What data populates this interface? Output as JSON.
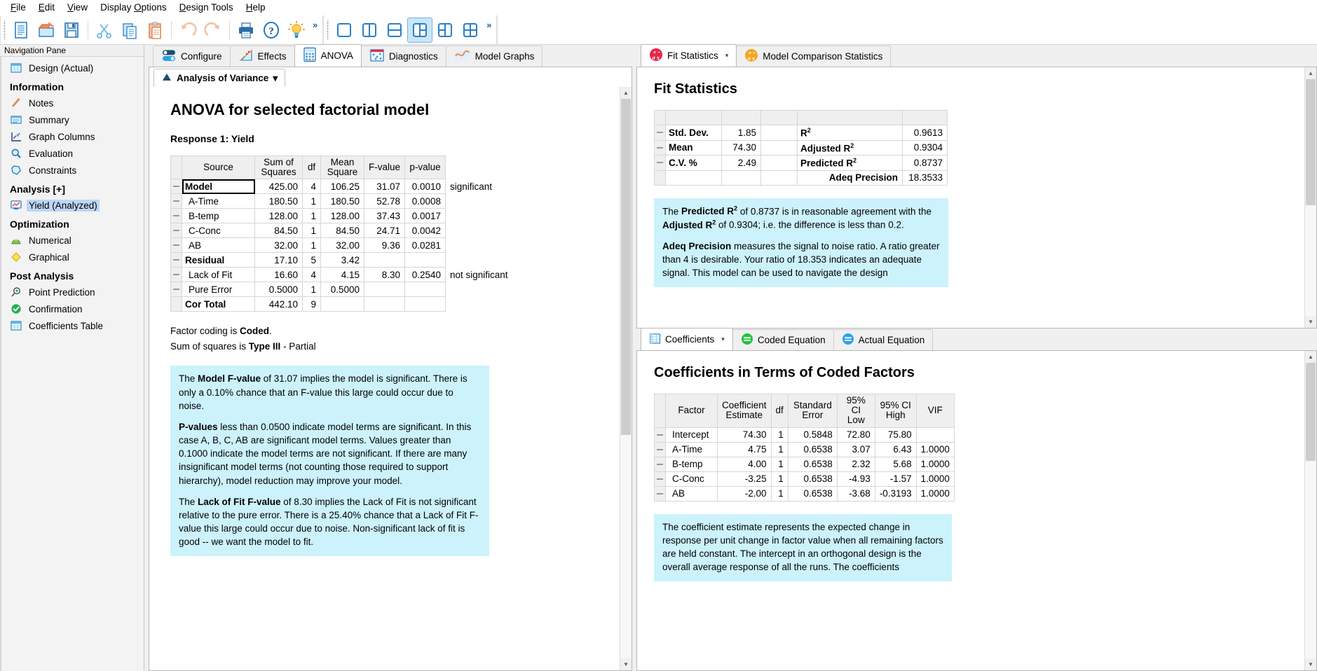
{
  "menu": {
    "items": [
      {
        "label": "File",
        "accel": "F"
      },
      {
        "label": "Edit",
        "accel": "E"
      },
      {
        "label": "View",
        "accel": "V"
      },
      {
        "label": "Display Options",
        "accel": "O"
      },
      {
        "label": "Design Tools",
        "accel": "D"
      },
      {
        "label": "Help",
        "accel": "H"
      }
    ]
  },
  "toolbar": {
    "group1": [
      "new-document-icon",
      "open-folder-icon",
      "save-disk-icon",
      "cut-scissors-icon",
      "copy-icon",
      "paste-icon",
      "undo-arrow-icon",
      "redo-arrow-icon",
      "print-icon",
      "help-question-icon",
      "tip-lightbulb-icon"
    ],
    "overflow_label": "»",
    "group2": [
      "layout-single-icon",
      "layout-two-column-icon",
      "layout-two-row-icon",
      "layout-left-split-icon",
      "layout-right-split-icon",
      "layout-quad-icon"
    ],
    "group2_selected_index": 3,
    "overflow2_label": "»"
  },
  "navigation": {
    "title": "Navigation Pane",
    "items": [
      {
        "label": "Design (Actual)",
        "icon": "grid-table-icon",
        "type": "item",
        "active": false
      },
      {
        "label": "Information",
        "type": "header"
      },
      {
        "label": "Notes",
        "icon": "pencil-icon",
        "type": "item",
        "active": false
      },
      {
        "label": "Summary",
        "icon": "summary-lines-icon",
        "type": "item",
        "active": false
      },
      {
        "label": "Graph Columns",
        "icon": "scatter-plot-icon",
        "type": "item",
        "active": false
      },
      {
        "label": "Evaluation",
        "icon": "magnifier-icon",
        "type": "item",
        "active": false
      },
      {
        "label": "Constraints",
        "icon": "polygon-icon",
        "type": "item",
        "active": false
      },
      {
        "label": "Analysis [+]",
        "type": "header"
      },
      {
        "label": "Yield (Analyzed)",
        "icon": "monitor-chart-icon",
        "type": "item",
        "active": true
      },
      {
        "label": "Optimization",
        "type": "header"
      },
      {
        "label": "Numerical",
        "icon": "hill-peak-icon",
        "type": "item",
        "active": false
      },
      {
        "label": "Graphical",
        "icon": "yellow-diamond-icon",
        "type": "item",
        "active": false
      },
      {
        "label": "Post Analysis",
        "type": "header"
      },
      {
        "label": "Point Prediction",
        "icon": "magnifier-plus-icon",
        "type": "item",
        "active": false
      },
      {
        "label": "Confirmation",
        "icon": "green-check-icon",
        "type": "item",
        "active": false
      },
      {
        "label": "Coefficients Table",
        "icon": "grid-table-icon",
        "type": "item",
        "active": false
      }
    ]
  },
  "left_panel": {
    "tabs": [
      {
        "label": "Configure",
        "icon": "toggle-switch-icon",
        "active": false
      },
      {
        "label": "Effects",
        "icon": "effects-plot-icon",
        "active": false
      },
      {
        "label": "ANOVA",
        "icon": "calculator-icon",
        "active": true
      },
      {
        "label": "Diagnostics",
        "icon": "diagnostics-dots-icon",
        "active": false
      },
      {
        "label": "Model Graphs",
        "icon": "model-curve-icon",
        "active": false
      }
    ],
    "subtab": {
      "label": "Analysis of Variance",
      "icon": "blue-triangle-icon",
      "caret": "▾"
    },
    "heading": "ANOVA for selected factorial model",
    "response": "Response 1: Yield",
    "anova_table": {
      "headers": [
        "Source",
        "Sum of Squares",
        "df",
        "Mean Square",
        "F-value",
        "p-value",
        ""
      ],
      "rows": [
        {
          "source": "Model",
          "bold": true,
          "selected": true,
          "ss": "425.00",
          "df": "4",
          "ms": "106.25",
          "f": "31.07",
          "p": "0.0010",
          "note": "significant"
        },
        {
          "source": "A-Time",
          "bold": false,
          "selected": false,
          "ss": "180.50",
          "df": "1",
          "ms": "180.50",
          "f": "52.78",
          "p": "0.0008",
          "note": ""
        },
        {
          "source": "B-temp",
          "bold": false,
          "selected": false,
          "ss": "128.00",
          "df": "1",
          "ms": "128.00",
          "f": "37.43",
          "p": "0.0017",
          "note": ""
        },
        {
          "source": "C-Conc",
          "bold": false,
          "selected": false,
          "ss": "84.50",
          "df": "1",
          "ms": "84.50",
          "f": "24.71",
          "p": "0.0042",
          "note": ""
        },
        {
          "source": "AB",
          "bold": false,
          "selected": false,
          "ss": "32.00",
          "df": "1",
          "ms": "32.00",
          "f": "9.36",
          "p": "0.0281",
          "note": ""
        },
        {
          "source": "Residual",
          "bold": true,
          "selected": false,
          "ss": "17.10",
          "df": "5",
          "ms": "3.42",
          "f": "",
          "p": "",
          "note": ""
        },
        {
          "source": "Lack of Fit",
          "bold": false,
          "selected": false,
          "ss": "16.60",
          "df": "4",
          "ms": "4.15",
          "f": "8.30",
          "p": "0.2540",
          "note": "not significant"
        },
        {
          "source": "Pure Error",
          "bold": false,
          "selected": false,
          "ss": "0.5000",
          "df": "1",
          "ms": "0.5000",
          "f": "",
          "p": "",
          "note": ""
        },
        {
          "source": "Cor Total",
          "bold": true,
          "selected": false,
          "ss": "442.10",
          "df": "9",
          "ms": "",
          "f": "",
          "p": "",
          "note": ""
        }
      ]
    },
    "footnotes": [
      {
        "prefix": "Factor coding is ",
        "bold": "Coded",
        "suffix": "."
      },
      {
        "prefix": "Sum of squares is ",
        "bold": "Type III",
        "suffix": " - Partial"
      }
    ],
    "infobox": [
      "The Model F-value of 31.07 implies the model is significant. There is only a 0.10% chance that an F-value this large could occur due to noise.",
      "P-values less than 0.0500 indicate model terms are significant. In this case A, B, C, AB are significant model terms. Values greater than 0.1000 indicate the model terms are not significant. If there are many insignificant model terms (not counting those required to support hierarchy), model reduction may improve your model.",
      "The Lack of Fit F-value of 8.30 implies the Lack of Fit is not significant relative to the pure error. There is a 25.40% chance that a Lack of Fit F-value this large could occur due to noise. Non-significant lack of fit is good -- we want the model to fit."
    ],
    "infobox_bold_terms": [
      "Model F-value",
      "P-values",
      "Lack of Fit F-value"
    ]
  },
  "right_panel": {
    "top_tabs": [
      {
        "label": "Fit Statistics",
        "icon": "sigma-red-icon",
        "active": true,
        "caret": "▾"
      },
      {
        "label": "Model Comparison Statistics",
        "icon": "sigma-orange-icon",
        "active": false
      }
    ],
    "fit_heading": "Fit Statistics",
    "fit_table": [
      {
        "l1": "Std. Dev.",
        "v1": "1.85",
        "l2": "R²",
        "v2": "0.9613"
      },
      {
        "l1": "Mean",
        "v1": "74.30",
        "l2": "Adjusted R²",
        "v2": "0.9304"
      },
      {
        "l1": "C.V. %",
        "v1": "2.49",
        "l2": "Predicted R²",
        "v2": "0.8737"
      },
      {
        "l1": "",
        "v1": "",
        "l2": "Adeq Precision",
        "v2": "18.3533"
      }
    ],
    "fit_infobox": [
      "The Predicted R² of 0.8737 is in reasonable agreement with the Adjusted R² of 0.9304; i.e. the difference is less than 0.2.",
      "Adeq Precision measures the signal to noise ratio. A ratio greater than 4 is desirable. Your ratio of 18.353 indicates an adequate signal. This model can be used to navigate the design"
    ],
    "bottom_tabs": [
      {
        "label": "Coefficients",
        "icon": "grid-table-icon",
        "active": true,
        "caret": "▾"
      },
      {
        "label": "Coded Equation",
        "icon": "green-equals-icon",
        "active": false
      },
      {
        "label": "Actual Equation",
        "icon": "blue-equals-icon",
        "active": false
      }
    ],
    "coef_heading": "Coefficients in Terms of Coded Factors",
    "coef_table": {
      "headers": [
        "Factor",
        "Coefficient Estimate",
        "df",
        "Standard Error",
        "95% CI Low",
        "95% CI High",
        "VIF"
      ],
      "rows": [
        {
          "factor": "Intercept",
          "est": "74.30",
          "df": "1",
          "se": "0.5848",
          "cilow": "72.80",
          "cihigh": "75.80",
          "vif": ""
        },
        {
          "factor": "A-Time",
          "est": "4.75",
          "df": "1",
          "se": "0.6538",
          "cilow": "3.07",
          "cihigh": "6.43",
          "vif": "1.0000"
        },
        {
          "factor": "B-temp",
          "est": "4.00",
          "df": "1",
          "se": "0.6538",
          "cilow": "2.32",
          "cihigh": "5.68",
          "vif": "1.0000"
        },
        {
          "factor": "C-Conc",
          "est": "-3.25",
          "df": "1",
          "se": "0.6538",
          "cilow": "-4.93",
          "cihigh": "-1.57",
          "vif": "1.0000"
        },
        {
          "factor": "AB",
          "est": "-2.00",
          "df": "1",
          "se": "0.6538",
          "cilow": "-3.68",
          "cihigh": "-0.3193",
          "vif": "1.0000"
        }
      ]
    },
    "coef_infobox": [
      "The coefficient estimate represents the expected change in response per unit change in factor value when all remaining factors are held constant. The intercept in an orthogonal design is the overall average response of all the runs. The coefficients"
    ]
  },
  "colors": {
    "accent_blue": "#1f7bc1",
    "info_bg": "#ccf2fc",
    "selection": "#bcd6f5",
    "red_badge": "#e8264a",
    "orange_badge": "#f5a623",
    "green_badge": "#22b14c"
  }
}
